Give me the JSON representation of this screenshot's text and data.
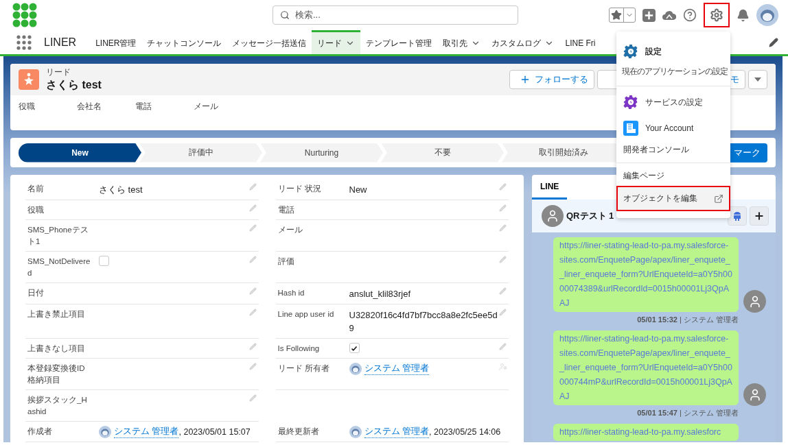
{
  "header": {
    "search": {
      "placeholder": "検索..."
    },
    "settings_annotated": true
  },
  "nav": {
    "app_name": "LINER",
    "tabs": [
      {
        "label": "LINER管理",
        "selected": false,
        "menu": false
      },
      {
        "label": "チャットコンソール",
        "selected": false,
        "menu": false
      },
      {
        "label": "メッセージ一括送信",
        "selected": false,
        "menu": false
      },
      {
        "label": "リード",
        "selected": true,
        "menu": true
      },
      {
        "label": "テンプレート管理",
        "selected": false,
        "menu": false
      },
      {
        "label": "取引先",
        "selected": false,
        "menu": true
      },
      {
        "label": "カスタムログ",
        "selected": false,
        "menu": true
      },
      {
        "label": "LINE Fri",
        "selected": false,
        "menu": false
      }
    ]
  },
  "record": {
    "object": "リード",
    "name": "さくら test",
    "actions": [
      "フォローする",
      "モ"
    ],
    "highlights": [
      "役職",
      "会社名",
      "電話",
      "メール"
    ]
  },
  "path": {
    "stages": [
      {
        "label": "New",
        "selected": true
      },
      {
        "label": "評価中",
        "selected": false
      },
      {
        "label": "Nurturing",
        "selected": false
      },
      {
        "label": "不要",
        "selected": false
      },
      {
        "label": "取引開始済み",
        "selected": false
      }
    ],
    "mark_button": "マーク"
  },
  "details": [
    {
      "left": {
        "label": "名前",
        "kind": "text",
        "value": "さくら test",
        "editable": true
      },
      "right": {
        "label": "リード 状況",
        "kind": "text",
        "value": "New",
        "editable": true
      }
    },
    {
      "left": {
        "label": "役職",
        "kind": "text",
        "editable": true
      },
      "right": {
        "label": "電話",
        "kind": "text",
        "editable": true
      }
    },
    {
      "left": {
        "label": "SMS_Phoneテスト1",
        "kind": "text",
        "editable": true
      },
      "right": {
        "label": "メール",
        "kind": "text",
        "editable": true
      }
    },
    {
      "left": {
        "label": "SMS_NotDelivered",
        "kind": "checkbox",
        "checked": false,
        "editable": true
      },
      "right": {
        "label": "評価",
        "kind": "text",
        "editable": true
      }
    },
    {
      "left": {
        "label": "日付",
        "kind": "text",
        "editable": true
      },
      "right": {
        "label": "Hash id",
        "kind": "text",
        "value": "anslut_klil83rjef",
        "editable": true
      }
    },
    {
      "left": {
        "label": "上書き禁止項目",
        "kind": "text",
        "editable": true
      },
      "right": {
        "label": "Line app user id",
        "kind": "text",
        "value": "U32820f16c4fd7bf7bcc8a8e2fc5ee5d9",
        "editable": true
      }
    },
    {
      "left": {
        "label": "上書きなし項目",
        "kind": "text",
        "editable": true
      },
      "right": {
        "label": "Is Following",
        "kind": "checkbox",
        "checked": true,
        "editable": true
      }
    },
    {
      "left": {
        "label": "本登録変換後ID格納項目",
        "kind": "text",
        "editable": true
      },
      "right": {
        "label": "リード 所有者",
        "kind": "user",
        "user": "システム 管理者",
        "editable": true
      }
    },
    {
      "left": {
        "label": "挨拶スタック_Hashid",
        "kind": "text",
        "editable": true
      }
    },
    {
      "left": {
        "label": "作成者",
        "kind": "user",
        "user": "システム 管理者",
        "suffix": ", 2023/05/01 15:07"
      },
      "right": {
        "label": "最終更新者",
        "kind": "user",
        "user": "システム 管理者",
        "suffix": ", 2023/05/25 14:06"
      }
    }
  ],
  "line_panel": {
    "tab": {
      "label": "LINE",
      "selected": true
    },
    "contact": "QRテスト 1",
    "messages": [
      {
        "text": "https://liner-stating-lead-to-pa.my.salesforce-sites.com/EnquetePage/apex/liner_enquete__liner_enquete_form?UrlEnqueteId=a0Y5h0000074389&urlRecordId=0015h00001Lj3QpAAJ",
        "meta": "**05/01 15:32** | システム 管理者"
      },
      {
        "text": "https://liner-stating-lead-to-pa.my.salesforce-sites.com/EnquetePage/apex/liner_enquete__liner_enquete_form?UrlEnqueteId=a0Y5h00000744mP&urlRecordId=0015h00001Lj3QpAAJ",
        "meta": "**05/01 15:47** | システム 管理者"
      },
      {
        "text": "https://liner-stating-lead-to-pa.my.salesforc"
      }
    ]
  },
  "setup_menu": {
    "groups": [
      [
        {
          "kind": "settings",
          "label": "設定",
          "subtitle": "現在のアプリケーションの設定",
          "selected": false,
          "annotated": false
        }
      ],
      [
        {
          "kind": "service",
          "label": "サービスの設定",
          "selected": false,
          "annotated": false
        },
        {
          "kind": "account",
          "label": "Your Account",
          "selected": false,
          "annotated": false
        },
        {
          "kind": "plain",
          "label": "開発者コンソール",
          "selected": false,
          "annotated": false
        }
      ],
      [
        {
          "kind": "plain",
          "label": "編集ページ",
          "selected": false,
          "annotated": false
        },
        {
          "kind": "external",
          "label": "オブジェクトを編集",
          "selected": true,
          "annotated": true
        }
      ]
    ]
  }
}
